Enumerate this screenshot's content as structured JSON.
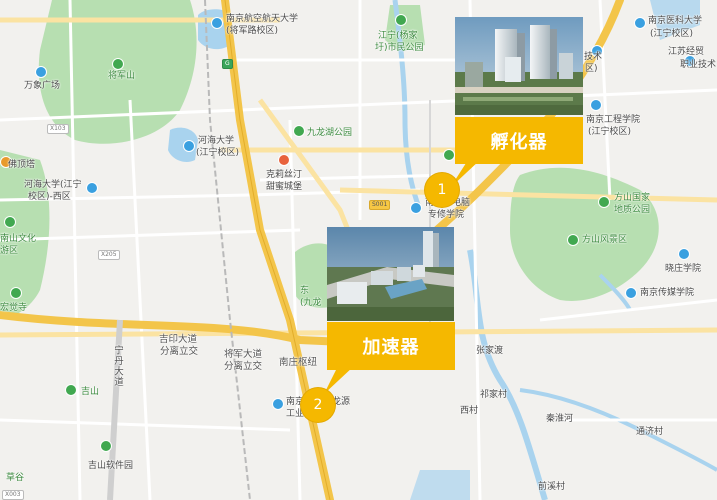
{
  "colors": {
    "background": "#f2f1ee",
    "park": "#b7dfb1",
    "water": "#a9d3ee",
    "highway": "#f3c54a",
    "arterial": "#ffffff",
    "callout": "#f5b800"
  },
  "labels": {
    "nuaa": "南京航空航天大学",
    "nuaa_campus": "(将军路校区)",
    "jiangning_park": "江宁(杨家",
    "jiangning_park2": "圩)市民公园",
    "njmu": "南京医科大学",
    "njmu_campus": "(江宁校区)",
    "tech_a": "技术",
    "tech_b": "区)",
    "vocational_a": "江苏经贸",
    "vocational_b": "职业技术",
    "jiangjun_mtn": "将军山",
    "wanda": "万象广场",
    "hohai": "河海大学",
    "hohai_campus": "(江宁校区)",
    "jiulong_park": "九龙湖公园",
    "engineering_a": "南京工程学院",
    "engineering_b": "(江宁校区)",
    "crane": "克莉丝汀",
    "crane2": "甜蜜城堡",
    "foding": "佛顶塔",
    "hohai_west": "河海大学(江宁",
    "hohai_west2": "校区)-西区",
    "cultural": "南山文化",
    "cultural2": "游区",
    "hongjue": "宏觉寺",
    "xiaohua": "南京华电脑",
    "xiaohua2": "专修学院",
    "fangshan_park": "方山国家",
    "fangshan_park2": "地质公园",
    "fangshan_scenic": "方山风景区",
    "xiaozhuang": "晓庄学院",
    "communication": "南京传媒学院",
    "east": "东",
    "jiulong_short": "(九龙",
    "jiyin": "吉印大道",
    "jiyin2": "分离立交",
    "jiangjun_rd": "将军大道",
    "jiangjun_rd2": "分离立交",
    "nanzhuang": "南庄枢纽",
    "danyang": "宁丹大道",
    "jishan": "吉山",
    "jishan_park": "吉山软件园",
    "caogu": "草谷",
    "zhangjiawei": "张家渡",
    "qijiacun": "祁家村",
    "xicun": "西村",
    "qinhuai": "秦淮河",
    "tongtai": "通济村",
    "qianxicun": "前溪村",
    "nanjing_partial": "南京",
    "industry": "工业",
    "longyuan": "龙源",
    "x103": "X103",
    "x205": "X205",
    "s001": "S001",
    "x003": "X003",
    "g": "G"
  },
  "callouts": [
    {
      "number": "1",
      "title": "孵化器"
    },
    {
      "number": "2",
      "title": "加速器"
    }
  ]
}
